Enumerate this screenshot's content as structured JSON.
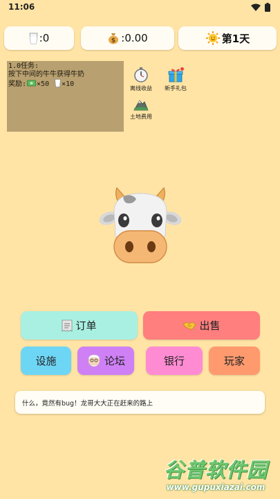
{
  "status_bar": {
    "time": "11:06"
  },
  "stats": {
    "milk": ":0",
    "money": ":0.00",
    "day": "第1天"
  },
  "task": {
    "title": "1.0任务:",
    "desc": "按下中间的牛牛获得牛奶",
    "reward_label": "奖励:",
    "reward_money": "×50",
    "reward_milk": "×10"
  },
  "side_items": {
    "offline": "离线收益",
    "gift": "新手礼包",
    "land": "土地费用"
  },
  "buttons": {
    "order": "订单",
    "sell": "出售",
    "facility": "设施",
    "forum": "论坛",
    "bank": "银行",
    "player": "玩家"
  },
  "message": "什么，竟然有bug！龙哥大大正在赶来的路上",
  "watermark": {
    "title": "谷普软件园",
    "url": "www.gupuxiazai.com"
  },
  "colors": {
    "background": "#FFE4A5",
    "order": "#A9F0E2",
    "sell": "#FF7E7E",
    "facility": "#6ED6F5",
    "forum": "#CF80F5",
    "bank": "#FF8CD3",
    "player": "#FF9A6E"
  },
  "icons": {
    "milk": "milk-glass-icon",
    "money": "money-bag-icon",
    "day": "sun-icon",
    "offline": "stopwatch-icon",
    "gift": "gift-icon",
    "land": "mountain-icon",
    "order": "receipt-icon",
    "sell": "handshake-icon",
    "forum": "old-man-icon"
  }
}
